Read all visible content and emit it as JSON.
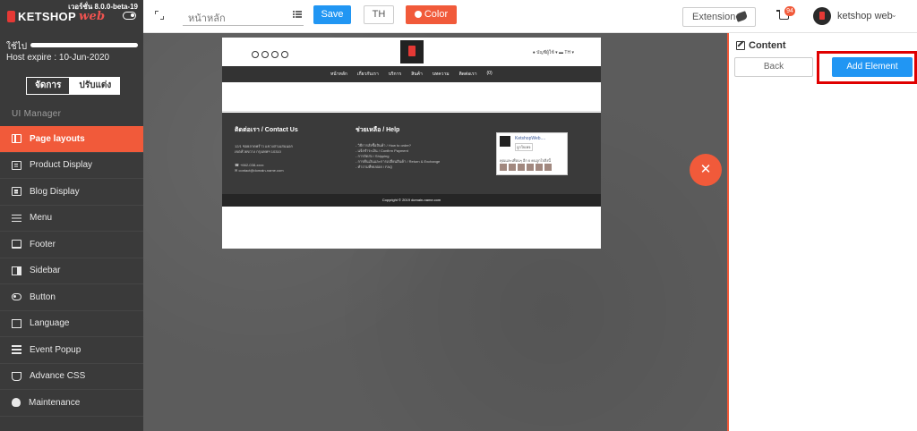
{
  "app": {
    "version": "เวอร์ชั่น 8.0.0-beta-19",
    "logo_text": "KETSHOP",
    "logo_suffix": "web",
    "usage_label": "ใช้ไป",
    "host_expire": "Host expire : 10-Jun-2020",
    "mode_manage": "จัดการ",
    "mode_design": "ปรับแต่ง",
    "section_title": "UI Manager"
  },
  "sidebar": {
    "items": [
      {
        "label": "Page layouts",
        "icon": "layout-icon"
      },
      {
        "label": "Product Display",
        "icon": "card-icon"
      },
      {
        "label": "Blog Display",
        "icon": "card-icon"
      },
      {
        "label": "Menu",
        "icon": "bars-icon"
      },
      {
        "label": "Footer",
        "icon": "monitor-icon"
      },
      {
        "label": "Sidebar",
        "icon": "sidebar-icon"
      },
      {
        "label": "Button",
        "icon": "toggle-icon"
      },
      {
        "label": "Language",
        "icon": "language-icon"
      },
      {
        "label": "Event Popup",
        "icon": "popup-icon"
      },
      {
        "label": "Advance CSS",
        "icon": "css-icon"
      },
      {
        "label": "Maintenance",
        "icon": "bug-icon"
      }
    ]
  },
  "toolbar": {
    "page_select_value": "หน้าหลัก",
    "save_label": "Save",
    "lang_label": "TH",
    "color_label": "Color",
    "extension_label": "Extension",
    "cart_count": "94",
    "user_name": "ketshop web"
  },
  "preview": {
    "nav_items": [
      "หน้าหลัก",
      "เกี่ยวกับเรา",
      "บริการ",
      "สินค้า",
      "บทความ",
      "ติดต่อเรา",
      "(0)"
    ],
    "account": "บัญชีผู้ใช้ ▾",
    "lang": "TH ▾",
    "contact_title": "ติดต่อเรา / Contact Us",
    "address_lines": [
      "12/1 ซอยลาดพร้าว แขวงสามเสนนอก",
      "เขตห้วยขวาง กรุงเทพฯ 10310"
    ],
    "contact_lines": [
      "☎ +662-038-xxxx",
      "✉ contact@domain-name.com"
    ],
    "help_title": "ช่วยเหลือ / Help",
    "help_lines": [
      "- วิธีการสั่งซื้อสินค้า / How to order?",
      "- แจ้งชำระเงิน / Confirm Payment",
      "- การจัดส่ง / Shipping",
      "- การคืนเงินและการเปลี่ยนสินค้า / Return & Exchange",
      "- คำถามที่พบบ่อย / FAQ"
    ],
    "fb_title": "KetshopWeb....",
    "fb_sub": "ถูกใจเพจ",
    "fb_text": "คุณและเพื่อนๆ อีก 6 คนถูกใจสิ่งนี้",
    "copyright": "Copyright © 2019 domain-name.com"
  },
  "panel": {
    "title": "Content",
    "back_label": "Back",
    "add_label": "Add Element"
  },
  "colors": {
    "accent": "#f15a3a",
    "primary": "#2196f3",
    "sidebar_bg": "#3a3a3a",
    "highlight": "#e00000"
  }
}
